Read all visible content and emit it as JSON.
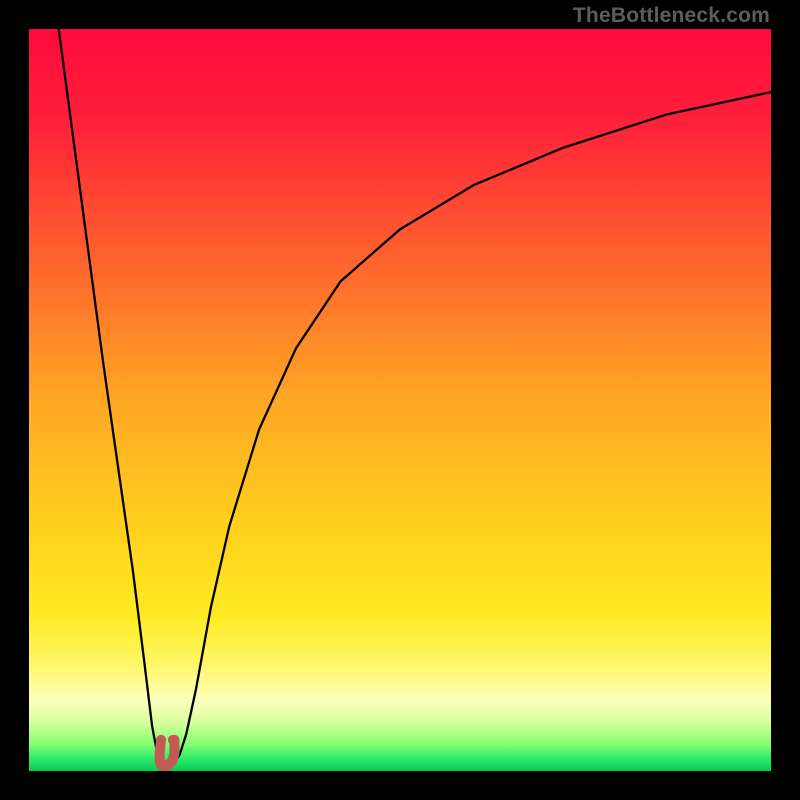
{
  "watermark": "TheBottleneck.com",
  "chart_data": {
    "type": "line",
    "title": "",
    "xlabel": "",
    "ylabel": "",
    "xlim": [
      0,
      100
    ],
    "ylim": [
      0,
      100
    ],
    "grid": false,
    "legend": false,
    "series": [
      {
        "name": "left-branch",
        "x": [
          4,
          6,
          8,
          10,
          12,
          14,
          15.5,
          16.6,
          17.3,
          17.8,
          18.1
        ],
        "y": [
          100,
          85,
          70,
          55,
          41,
          27,
          15,
          6,
          2.3,
          1.3,
          1.0
        ]
      },
      {
        "name": "right-branch",
        "x": [
          19.1,
          19.6,
          20.3,
          21.2,
          22.5,
          24.5,
          27,
          31,
          36,
          42,
          50,
          60,
          72,
          86,
          100
        ],
        "y": [
          1.0,
          1.2,
          2.2,
          5,
          11,
          22,
          33,
          46,
          57,
          66,
          73,
          79,
          84,
          88.5,
          91.5
        ]
      },
      {
        "name": "valley-marker",
        "x": [
          17.8,
          17.6,
          17.6,
          17.9,
          18.6,
          19.3,
          19.6,
          19.6,
          19.4
        ],
        "y": [
          4.2,
          2.4,
          1.3,
          0.7,
          0.7,
          1.3,
          2.4,
          4.2,
          4.2
        ]
      }
    ],
    "gradient_stops": [
      {
        "offset": 0.0,
        "color": "#ff0a3b"
      },
      {
        "offset": 0.12,
        "color": "#ff1f3a"
      },
      {
        "offset": 0.3,
        "color": "#ff5f2e"
      },
      {
        "offset": 0.5,
        "color": "#ffa724"
      },
      {
        "offset": 0.68,
        "color": "#ffd21e"
      },
      {
        "offset": 0.79,
        "color": "#ffea22"
      },
      {
        "offset": 0.855,
        "color": "#fff766"
      },
      {
        "offset": 0.905,
        "color": "#fcffbe"
      },
      {
        "offset": 0.935,
        "color": "#d6ff9a"
      },
      {
        "offset": 0.965,
        "color": "#7fff6e"
      },
      {
        "offset": 0.985,
        "color": "#26e96a"
      },
      {
        "offset": 1.0,
        "color": "#09c957"
      }
    ],
    "valley_color": "#c45a54",
    "curve_color": "#000000"
  }
}
